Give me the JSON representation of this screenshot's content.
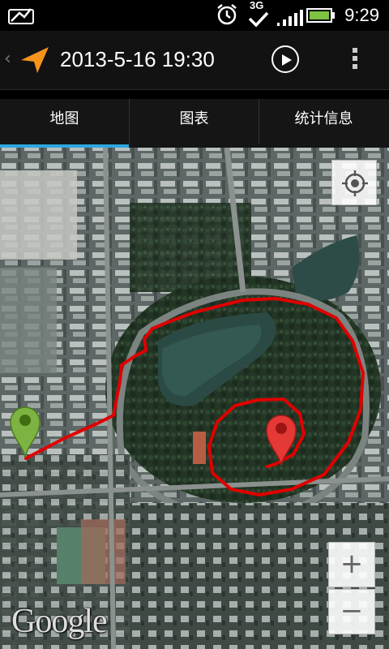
{
  "status_bar": {
    "time": "9:29",
    "network": "3G",
    "icons": [
      "notification-icon",
      "alarm-icon",
      "network-3g-icon",
      "signal-icon",
      "battery-icon"
    ]
  },
  "app_bar": {
    "title": "2013-5-16 19:30",
    "app_icon": "navigation-arrow-icon",
    "actions": [
      "play-icon",
      "overflow-menu-icon"
    ],
    "accent": "#F7941D"
  },
  "tabs": [
    {
      "label": "地图",
      "selected": true
    },
    {
      "label": "图表",
      "selected": false
    },
    {
      "label": "统计信息",
      "selected": false
    }
  ],
  "tab_indicator_color": "#2EA7E0",
  "map": {
    "attribution": "Google",
    "track_color": "#E00000",
    "start_marker_color": "#7CB342",
    "end_marker_color": "#E53935",
    "controls": {
      "zoom_in": "+",
      "zoom_out": "−"
    }
  }
}
